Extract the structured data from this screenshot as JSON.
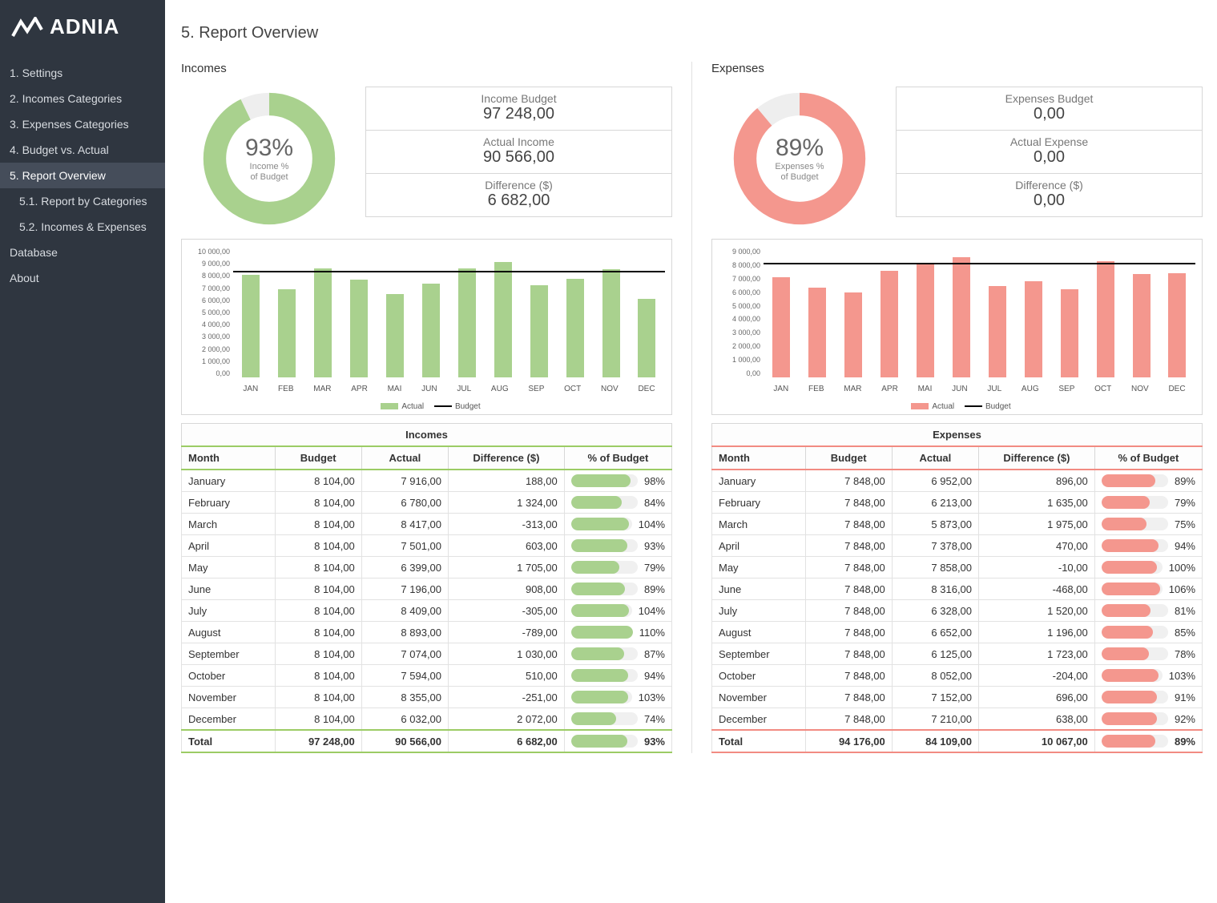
{
  "brand": "ADNIA",
  "page_title": "5. Report Overview",
  "sidebar": {
    "items": [
      {
        "label": "1. Settings"
      },
      {
        "label": "2. Incomes Categories"
      },
      {
        "label": "3. Expenses Categories"
      },
      {
        "label": "4. Budget vs. Actual"
      },
      {
        "label": "5. Report Overview",
        "active": true
      },
      {
        "label": "5.1. Report by Categories",
        "sub": true
      },
      {
        "label": "5.2. Incomes & Expenses",
        "sub": true
      },
      {
        "label": "Database"
      },
      {
        "label": "About"
      }
    ]
  },
  "columns": {
    "month": "Month",
    "budget": "Budget",
    "actual": "Actual",
    "diff": "Difference ($)",
    "pct": "% of Budget"
  },
  "legend": {
    "actual": "Actual",
    "budget": "Budget"
  },
  "months_short": [
    "JAN",
    "FEB",
    "MAR",
    "APR",
    "MAI",
    "JUN",
    "JUL",
    "AUG",
    "SEP",
    "OCT",
    "NOV",
    "DEC"
  ],
  "months_long": [
    "January",
    "February",
    "March",
    "April",
    "May",
    "June",
    "July",
    "August",
    "September",
    "October",
    "November",
    "December"
  ],
  "total_label": "Total",
  "incomes": {
    "title": "Incomes",
    "donut_pct": "93%",
    "donut_sub1": "Income %",
    "donut_sub2": "of Budget",
    "stats": {
      "budget_label": "Income Budget",
      "budget_value": "97 248,00",
      "actual_label": "Actual Income",
      "actual_value": "90 566,00",
      "diff_label": "Difference ($)",
      "diff_value": "6 682,00"
    },
    "table": [
      {
        "budget": "8 104,00",
        "actual": "7 916,00",
        "diff": "188,00",
        "pct": "98%"
      },
      {
        "budget": "8 104,00",
        "actual": "6 780,00",
        "diff": "1 324,00",
        "pct": "84%"
      },
      {
        "budget": "8 104,00",
        "actual": "8 417,00",
        "diff": "-313,00",
        "pct": "104%"
      },
      {
        "budget": "8 104,00",
        "actual": "7 501,00",
        "diff": "603,00",
        "pct": "93%"
      },
      {
        "budget": "8 104,00",
        "actual": "6 399,00",
        "diff": "1 705,00",
        "pct": "79%"
      },
      {
        "budget": "8 104,00",
        "actual": "7 196,00",
        "diff": "908,00",
        "pct": "89%"
      },
      {
        "budget": "8 104,00",
        "actual": "8 409,00",
        "diff": "-305,00",
        "pct": "104%"
      },
      {
        "budget": "8 104,00",
        "actual": "8 893,00",
        "diff": "-789,00",
        "pct": "110%"
      },
      {
        "budget": "8 104,00",
        "actual": "7 074,00",
        "diff": "1 030,00",
        "pct": "87%"
      },
      {
        "budget": "8 104,00",
        "actual": "7 594,00",
        "diff": "510,00",
        "pct": "94%"
      },
      {
        "budget": "8 104,00",
        "actual": "8 355,00",
        "diff": "-251,00",
        "pct": "103%"
      },
      {
        "budget": "8 104,00",
        "actual": "6 032,00",
        "diff": "2 072,00",
        "pct": "74%"
      }
    ],
    "total": {
      "budget": "97 248,00",
      "actual": "90 566,00",
      "diff": "6 682,00",
      "pct": "93%"
    },
    "chart_values": [
      7916,
      6780,
      8417,
      7501,
      6399,
      7196,
      8409,
      8893,
      7074,
      7594,
      8355,
      6032
    ],
    "chart_budget": 8104,
    "ymax": 10000
  },
  "expenses": {
    "title": "Expenses",
    "donut_pct": "89%",
    "donut_sub1": "Expenses %",
    "donut_sub2": "of Budget",
    "stats": {
      "budget_label": "Expenses Budget",
      "budget_value": "0,00",
      "actual_label": "Actual Expense",
      "actual_value": "0,00",
      "diff_label": "Difference ($)",
      "diff_value": "0,00"
    },
    "table": [
      {
        "budget": "7 848,00",
        "actual": "6 952,00",
        "diff": "896,00",
        "pct": "89%"
      },
      {
        "budget": "7 848,00",
        "actual": "6 213,00",
        "diff": "1 635,00",
        "pct": "79%"
      },
      {
        "budget": "7 848,00",
        "actual": "5 873,00",
        "diff": "1 975,00",
        "pct": "75%"
      },
      {
        "budget": "7 848,00",
        "actual": "7 378,00",
        "diff": "470,00",
        "pct": "94%"
      },
      {
        "budget": "7 848,00",
        "actual": "7 858,00",
        "diff": "-10,00",
        "pct": "100%"
      },
      {
        "budget": "7 848,00",
        "actual": "8 316,00",
        "diff": "-468,00",
        "pct": "106%"
      },
      {
        "budget": "7 848,00",
        "actual": "6 328,00",
        "diff": "1 520,00",
        "pct": "81%"
      },
      {
        "budget": "7 848,00",
        "actual": "6 652,00",
        "diff": "1 196,00",
        "pct": "85%"
      },
      {
        "budget": "7 848,00",
        "actual": "6 125,00",
        "diff": "1 723,00",
        "pct": "78%"
      },
      {
        "budget": "7 848,00",
        "actual": "8 052,00",
        "diff": "-204,00",
        "pct": "103%"
      },
      {
        "budget": "7 848,00",
        "actual": "7 152,00",
        "diff": "696,00",
        "pct": "91%"
      },
      {
        "budget": "7 848,00",
        "actual": "7 210,00",
        "diff": "638,00",
        "pct": "92%"
      }
    ],
    "total": {
      "budget": "94 176,00",
      "actual": "84 109,00",
      "diff": "10 067,00",
      "pct": "89%"
    },
    "chart_values": [
      6952,
      6213,
      5873,
      7378,
      7858,
      8316,
      6328,
      6652,
      6125,
      8052,
      7152,
      7210
    ],
    "chart_budget": 7848,
    "ymax": 9000
  },
  "yticks_incomes": [
    "0,00",
    "1 000,00",
    "2 000,00",
    "3 000,00",
    "4 000,00",
    "5 000,00",
    "6 000,00",
    "7 000,00",
    "8 000,00",
    "9 000,00",
    "10 000,00"
  ],
  "yticks_expenses": [
    "0,00",
    "1 000,00",
    "2 000,00",
    "3 000,00",
    "4 000,00",
    "5 000,00",
    "6 000,00",
    "7 000,00",
    "8 000,00",
    "9 000,00"
  ],
  "colors": {
    "green": "#a9d18e",
    "red": "#f4978e"
  },
  "chart_data": [
    {
      "type": "bar",
      "title": "Incomes – Actual vs Budget",
      "categories": [
        "JAN",
        "FEB",
        "MAR",
        "APR",
        "MAI",
        "JUN",
        "JUL",
        "AUG",
        "SEP",
        "OCT",
        "NOV",
        "DEC"
      ],
      "series": [
        {
          "name": "Actual",
          "values": [
            7916,
            6780,
            8417,
            7501,
            6399,
            7196,
            8409,
            8893,
            7074,
            7594,
            8355,
            6032
          ]
        },
        {
          "name": "Budget",
          "values": [
            8104,
            8104,
            8104,
            8104,
            8104,
            8104,
            8104,
            8104,
            8104,
            8104,
            8104,
            8104
          ]
        }
      ],
      "ylim": [
        0,
        10000
      ]
    },
    {
      "type": "bar",
      "title": "Expenses – Actual vs Budget",
      "categories": [
        "JAN",
        "FEB",
        "MAR",
        "APR",
        "MAI",
        "JUN",
        "JUL",
        "AUG",
        "SEP",
        "OCT",
        "NOV",
        "DEC"
      ],
      "series": [
        {
          "name": "Actual",
          "values": [
            6952,
            6213,
            5873,
            7378,
            7858,
            8316,
            6328,
            6652,
            6125,
            8052,
            7152,
            7210
          ]
        },
        {
          "name": "Budget",
          "values": [
            7848,
            7848,
            7848,
            7848,
            7848,
            7848,
            7848,
            7848,
            7848,
            7848,
            7848,
            7848
          ]
        }
      ],
      "ylim": [
        0,
        9000
      ]
    },
    {
      "type": "pie",
      "title": "Income % of Budget",
      "series": [
        {
          "name": "Income % of Budget",
          "values": [
            93,
            7
          ]
        }
      ]
    },
    {
      "type": "pie",
      "title": "Expenses % of Budget",
      "series": [
        {
          "name": "Expenses % of Budget",
          "values": [
            89,
            11
          ]
        }
      ]
    }
  ]
}
